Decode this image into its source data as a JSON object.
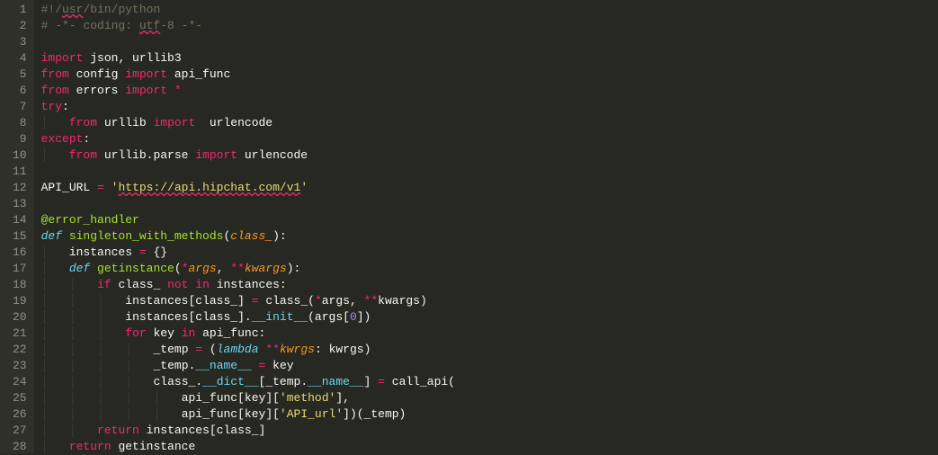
{
  "editor": {
    "theme": "monokai",
    "font_family": "Consolas",
    "line_height_px": 18,
    "first_visible_line": 1,
    "last_visible_line": 28,
    "line_numbers": [
      "1",
      "2",
      "3",
      "4",
      "5",
      "6",
      "7",
      "8",
      "9",
      "10",
      "11",
      "12",
      "13",
      "14",
      "15",
      "16",
      "17",
      "18",
      "19",
      "20",
      "21",
      "22",
      "23",
      "24",
      "25",
      "26",
      "27",
      "28"
    ],
    "lines": [
      {
        "n": 1,
        "tokens": [
          {
            "t": "#!",
            "c": "comment"
          },
          {
            "t": "/",
            "c": "comment"
          },
          {
            "t": "usr",
            "c": "comment",
            "sq": true
          },
          {
            "t": "/bin/python",
            "c": "comment"
          }
        ]
      },
      {
        "n": 2,
        "tokens": [
          {
            "t": "# -*- coding: ",
            "c": "comment"
          },
          {
            "t": "utf",
            "c": "comment",
            "sq": true
          },
          {
            "t": "-8 -*-",
            "c": "comment"
          }
        ]
      },
      {
        "n": 3,
        "tokens": [
          {
            "t": "",
            "c": "default"
          }
        ]
      },
      {
        "n": 4,
        "tokens": [
          {
            "t": "import",
            "c": "keyword"
          },
          {
            "t": " json",
            "c": "default"
          },
          {
            "t": ",",
            "c": "default"
          },
          {
            "t": " urllib3",
            "c": "default"
          }
        ]
      },
      {
        "n": 5,
        "tokens": [
          {
            "t": "from",
            "c": "keyword"
          },
          {
            "t": " config ",
            "c": "default"
          },
          {
            "t": "import",
            "c": "keyword"
          },
          {
            "t": " api_func",
            "c": "default"
          }
        ]
      },
      {
        "n": 6,
        "tokens": [
          {
            "t": "from",
            "c": "keyword"
          },
          {
            "t": " errors ",
            "c": "default"
          },
          {
            "t": "import",
            "c": "keyword"
          },
          {
            "t": " ",
            "c": "default"
          },
          {
            "t": "*",
            "c": "op"
          }
        ]
      },
      {
        "n": 7,
        "tokens": [
          {
            "t": "try",
            "c": "keyword"
          },
          {
            "t": ":",
            "c": "default"
          }
        ]
      },
      {
        "n": 8,
        "indent": 1,
        "tokens": [
          {
            "t": "from",
            "c": "keyword"
          },
          {
            "t": " urllib ",
            "c": "default"
          },
          {
            "t": "import",
            "c": "keyword"
          },
          {
            "t": "  urlencode",
            "c": "default"
          }
        ]
      },
      {
        "n": 9,
        "tokens": [
          {
            "t": "except",
            "c": "keyword"
          },
          {
            "t": ":",
            "c": "default"
          }
        ]
      },
      {
        "n": 10,
        "indent": 1,
        "tokens": [
          {
            "t": "from",
            "c": "keyword"
          },
          {
            "t": " urllib.parse ",
            "c": "default"
          },
          {
            "t": "import",
            "c": "keyword"
          },
          {
            "t": " urlencode",
            "c": "default"
          }
        ]
      },
      {
        "n": 11,
        "tokens": [
          {
            "t": "",
            "c": "default"
          }
        ]
      },
      {
        "n": 12,
        "tokens": [
          {
            "t": "API_URL ",
            "c": "default"
          },
          {
            "t": "=",
            "c": "op"
          },
          {
            "t": " ",
            "c": "default"
          },
          {
            "t": "'",
            "c": "string"
          },
          {
            "t": "https://api.hipchat.com/v1",
            "c": "string",
            "sq": true
          },
          {
            "t": "'",
            "c": "string"
          }
        ]
      },
      {
        "n": 13,
        "tokens": [
          {
            "t": "",
            "c": "default"
          }
        ]
      },
      {
        "n": 14,
        "tokens": [
          {
            "t": "@",
            "c": "decor"
          },
          {
            "t": "error_handler",
            "c": "decor"
          }
        ]
      },
      {
        "n": 15,
        "tokens": [
          {
            "t": "def",
            "c": "storage"
          },
          {
            "t": " ",
            "c": "default"
          },
          {
            "t": "singleton_with_methods",
            "c": "funcname"
          },
          {
            "t": "(",
            "c": "default"
          },
          {
            "t": "class_",
            "c": "param"
          },
          {
            "t": "):",
            "c": "default"
          }
        ]
      },
      {
        "n": 16,
        "indent": 1,
        "tokens": [
          {
            "t": "instances ",
            "c": "default"
          },
          {
            "t": "=",
            "c": "op"
          },
          {
            "t": " {}",
            "c": "default"
          }
        ]
      },
      {
        "n": 17,
        "indent": 1,
        "tokens": [
          {
            "t": "def",
            "c": "storage"
          },
          {
            "t": " ",
            "c": "default"
          },
          {
            "t": "getinstance",
            "c": "funcname"
          },
          {
            "t": "(",
            "c": "default"
          },
          {
            "t": "*",
            "c": "op"
          },
          {
            "t": "args",
            "c": "param"
          },
          {
            "t": ", ",
            "c": "default"
          },
          {
            "t": "**",
            "c": "op"
          },
          {
            "t": "kwargs",
            "c": "param"
          },
          {
            "t": "):",
            "c": "default"
          }
        ]
      },
      {
        "n": 18,
        "indent": 2,
        "tokens": [
          {
            "t": "if",
            "c": "keyword"
          },
          {
            "t": " class_ ",
            "c": "default"
          },
          {
            "t": "not",
            "c": "op"
          },
          {
            "t": " ",
            "c": "default"
          },
          {
            "t": "in",
            "c": "op"
          },
          {
            "t": " instances:",
            "c": "default"
          }
        ]
      },
      {
        "n": 19,
        "indent": 3,
        "tokens": [
          {
            "t": "instances[class_] ",
            "c": "default"
          },
          {
            "t": "=",
            "c": "op"
          },
          {
            "t": " class_(",
            "c": "default"
          },
          {
            "t": "*",
            "c": "op"
          },
          {
            "t": "args, ",
            "c": "default"
          },
          {
            "t": "**",
            "c": "op"
          },
          {
            "t": "kwargs)",
            "c": "default"
          }
        ]
      },
      {
        "n": 20,
        "indent": 3,
        "tokens": [
          {
            "t": "instances[class_].",
            "c": "default"
          },
          {
            "t": "__init__",
            "c": "builtin"
          },
          {
            "t": "(args[",
            "c": "default"
          },
          {
            "t": "0",
            "c": "number"
          },
          {
            "t": "])",
            "c": "default"
          }
        ]
      },
      {
        "n": 21,
        "indent": 3,
        "tokens": [
          {
            "t": "for",
            "c": "keyword"
          },
          {
            "t": " key ",
            "c": "default"
          },
          {
            "t": "in",
            "c": "op"
          },
          {
            "t": " api_func:",
            "c": "default"
          }
        ]
      },
      {
        "n": 22,
        "indent": 4,
        "tokens": [
          {
            "t": "_temp ",
            "c": "default"
          },
          {
            "t": "=",
            "c": "op"
          },
          {
            "t": " (",
            "c": "default"
          },
          {
            "t": "lambda",
            "c": "storage"
          },
          {
            "t": " ",
            "c": "default"
          },
          {
            "t": "**",
            "c": "op"
          },
          {
            "t": "kwrgs",
            "c": "param"
          },
          {
            "t": ": kwrgs)",
            "c": "default"
          }
        ]
      },
      {
        "n": 23,
        "indent": 4,
        "tokens": [
          {
            "t": "_temp.",
            "c": "default"
          },
          {
            "t": "__name__",
            "c": "builtin"
          },
          {
            "t": " ",
            "c": "default"
          },
          {
            "t": "=",
            "c": "op"
          },
          {
            "t": " key",
            "c": "default"
          }
        ]
      },
      {
        "n": 24,
        "indent": 4,
        "tokens": [
          {
            "t": "class_.",
            "c": "default"
          },
          {
            "t": "__dict__",
            "c": "builtin"
          },
          {
            "t": "[_temp.",
            "c": "default"
          },
          {
            "t": "__name__",
            "c": "builtin"
          },
          {
            "t": "] ",
            "c": "default"
          },
          {
            "t": "=",
            "c": "op"
          },
          {
            "t": " call_api(",
            "c": "default"
          }
        ]
      },
      {
        "n": 25,
        "indent": 5,
        "tokens": [
          {
            "t": "api_func[key][",
            "c": "default"
          },
          {
            "t": "'method'",
            "c": "string"
          },
          {
            "t": "],",
            "c": "default"
          }
        ]
      },
      {
        "n": 26,
        "indent": 5,
        "tokens": [
          {
            "t": "api_func[key][",
            "c": "default"
          },
          {
            "t": "'API_url'",
            "c": "string"
          },
          {
            "t": "])(_temp)",
            "c": "default"
          }
        ]
      },
      {
        "n": 27,
        "indent": 2,
        "tokens": [
          {
            "t": "return",
            "c": "keyword"
          },
          {
            "t": " instances[class_]",
            "c": "default"
          }
        ]
      },
      {
        "n": 28,
        "indent": 1,
        "tokens": [
          {
            "t": "return",
            "c": "keyword"
          },
          {
            "t": " getinstance",
            "c": "default"
          }
        ]
      }
    ]
  },
  "colors": {
    "background": "#272822",
    "gutter_bg": "#2f3129",
    "gutter_fg": "#8f908a",
    "default": "#f8f8f2",
    "comment": "#75715e",
    "keyword": "#f92672",
    "storage": "#66d9ef",
    "funcname": "#a6e22e",
    "param": "#fd971f",
    "string": "#e6db74",
    "number": "#ae81ff",
    "builtin": "#66d9ef",
    "decor": "#a6e22e",
    "error_underline": "#f92672"
  }
}
